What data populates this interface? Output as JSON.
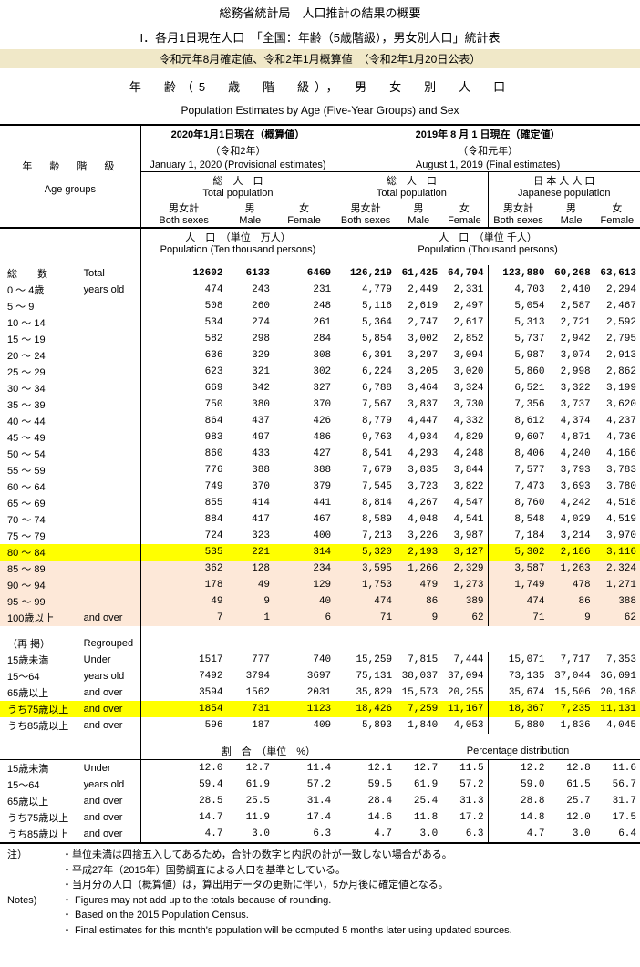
{
  "hdr1": "総務省統計局　人口推計の結果の概要",
  "hdr2": "I．各月1日現在人口　「全国：年齢（5歳階級），男女別人口」統計表",
  "band": "令和元年8月確定値、令和2年1月概算値　（令和2年1月20日公表）",
  "title_j": "年　齢（5　歳　階　級），　男　女　別　人　口",
  "title_e": "Population Estimates by  Age (Five-Year Groups) and  Sex",
  "colh": {
    "date1_j": "2020年1月1日現在（概算値）",
    "date1_sub": "（令和2年）",
    "date1_e": "January 1, 2020 (Provisional estimates)",
    "date2_j": "2019年 8 月 1 日現在（確定値）",
    "date2_sub": "（令和元年）",
    "date2_e": "August 1, 2019  (Final estimates)",
    "age_j": "年　齢　階　級",
    "age_e": "Age groups",
    "tot_j": "総　人　口",
    "tot_e": "Total  population",
    "jpn_j": "日 本 人 人 口",
    "jpn_e": "Japanese  population",
    "both_j": "男女計",
    "both_e": "Both sexes",
    "m_j": "男",
    "m_e": "Male",
    "f_j": "女",
    "f_e": "Female",
    "unit1_j": "人　口　（単位　万人）",
    "unit1_e": "Population  (Ten thousand persons)",
    "unit2_j": "人　口　（単位 千人）",
    "unit2_e": "Population   (Thousand persons)"
  },
  "rows": [
    {
      "j": "総　　数",
      "e": "Total",
      "a": [
        "12602",
        "6133",
        "6469"
      ],
      "b": [
        "126,219",
        "61,425",
        "64,794"
      ],
      "c": [
        "123,880",
        "60,268",
        "63,613"
      ],
      "bold": true
    },
    {
      "j": " 0 ～  4歳",
      "e": "years old",
      "a": [
        "474",
        "243",
        "231"
      ],
      "b": [
        "4,779",
        "2,449",
        "2,331"
      ],
      "c": [
        "4,703",
        "2,410",
        "2,294"
      ]
    },
    {
      "j": " 5 ～  9",
      "e": "",
      "a": [
        "508",
        "260",
        "248"
      ],
      "b": [
        "5,116",
        "2,619",
        "2,497"
      ],
      "c": [
        "5,054",
        "2,587",
        "2,467"
      ]
    },
    {
      "j": "10 ～ 14",
      "e": "",
      "a": [
        "534",
        "274",
        "261"
      ],
      "b": [
        "5,364",
        "2,747",
        "2,617"
      ],
      "c": [
        "5,313",
        "2,721",
        "2,592"
      ]
    },
    {
      "j": "15 ～ 19",
      "e": "",
      "a": [
        "582",
        "298",
        "284"
      ],
      "b": [
        "5,854",
        "3,002",
        "2,852"
      ],
      "c": [
        "5,737",
        "2,942",
        "2,795"
      ]
    },
    {
      "j": "20 ～ 24",
      "e": "",
      "a": [
        "636",
        "329",
        "308"
      ],
      "b": [
        "6,391",
        "3,297",
        "3,094"
      ],
      "c": [
        "5,987",
        "3,074",
        "2,913"
      ]
    },
    {
      "j": "25 ～ 29",
      "e": "",
      "a": [
        "623",
        "321",
        "302"
      ],
      "b": [
        "6,224",
        "3,205",
        "3,020"
      ],
      "c": [
        "5,860",
        "2,998",
        "2,862"
      ]
    },
    {
      "j": "30 ～ 34",
      "e": "",
      "a": [
        "669",
        "342",
        "327"
      ],
      "b": [
        "6,788",
        "3,464",
        "3,324"
      ],
      "c": [
        "6,521",
        "3,322",
        "3,199"
      ]
    },
    {
      "j": "35 ～ 39",
      "e": "",
      "a": [
        "750",
        "380",
        "370"
      ],
      "b": [
        "7,567",
        "3,837",
        "3,730"
      ],
      "c": [
        "7,356",
        "3,737",
        "3,620"
      ]
    },
    {
      "j": "40 ～ 44",
      "e": "",
      "a": [
        "864",
        "437",
        "426"
      ],
      "b": [
        "8,779",
        "4,447",
        "4,332"
      ],
      "c": [
        "8,612",
        "4,374",
        "4,237"
      ]
    },
    {
      "j": "45 ～ 49",
      "e": "",
      "a": [
        "983",
        "497",
        "486"
      ],
      "b": [
        "9,763",
        "4,934",
        "4,829"
      ],
      "c": [
        "9,607",
        "4,871",
        "4,736"
      ]
    },
    {
      "j": "50 ～ 54",
      "e": "",
      "a": [
        "860",
        "433",
        "427"
      ],
      "b": [
        "8,541",
        "4,293",
        "4,248"
      ],
      "c": [
        "8,406",
        "4,240",
        "4,166"
      ]
    },
    {
      "j": "55 ～ 59",
      "e": "",
      "a": [
        "776",
        "388",
        "388"
      ],
      "b": [
        "7,679",
        "3,835",
        "3,844"
      ],
      "c": [
        "7,577",
        "3,793",
        "3,783"
      ]
    },
    {
      "j": "60 ～ 64",
      "e": "",
      "a": [
        "749",
        "370",
        "379"
      ],
      "b": [
        "7,545",
        "3,723",
        "3,822"
      ],
      "c": [
        "7,473",
        "3,693",
        "3,780"
      ]
    },
    {
      "j": "65 ～ 69",
      "e": "",
      "a": [
        "855",
        "414",
        "441"
      ],
      "b": [
        "8,814",
        "4,267",
        "4,547"
      ],
      "c": [
        "8,760",
        "4,242",
        "4,518"
      ]
    },
    {
      "j": "70 ～ 74",
      "e": "",
      "a": [
        "884",
        "417",
        "467"
      ],
      "b": [
        "8,589",
        "4,048",
        "4,541"
      ],
      "c": [
        "8,548",
        "4,029",
        "4,519"
      ]
    },
    {
      "j": "75 ～ 79",
      "e": "",
      "a": [
        "724",
        "323",
        "400"
      ],
      "b": [
        "7,213",
        "3,226",
        "3,987"
      ],
      "c": [
        "7,184",
        "3,214",
        "3,970"
      ]
    },
    {
      "j": "80 ～ 84",
      "e": "",
      "a": [
        "535",
        "221",
        "314"
      ],
      "b": [
        "5,320",
        "2,193",
        "3,127"
      ],
      "c": [
        "5,302",
        "2,186",
        "3,116"
      ],
      "hl": true
    },
    {
      "j": "85 ～ 89",
      "e": "",
      "a": [
        "362",
        "128",
        "234"
      ],
      "b": [
        "3,595",
        "1,266",
        "2,329"
      ],
      "c": [
        "3,587",
        "1,263",
        "2,324"
      ],
      "pk": true
    },
    {
      "j": "90 ～ 94",
      "e": "",
      "a": [
        "178",
        "49",
        "129"
      ],
      "b": [
        "1,753",
        "479",
        "1,273"
      ],
      "c": [
        "1,749",
        "478",
        "1,271"
      ],
      "pk": true
    },
    {
      "j": "95 ～ 99",
      "e": "",
      "a": [
        "49",
        "9",
        "40"
      ],
      "b": [
        "474",
        "86",
        "389"
      ],
      "c": [
        "474",
        "86",
        "388"
      ],
      "pk": true
    },
    {
      "j": "100歳以上",
      "e": "and over",
      "a": [
        "7",
        "1",
        "6"
      ],
      "b": [
        "71",
        "9",
        "62"
      ],
      "c": [
        "71",
        "9",
        "62"
      ],
      "pk": true
    }
  ],
  "regroup_j": "（再 掲）",
  "regroup_e": "Regrouped",
  "rg": [
    {
      "j": "15歳未満",
      "e": "Under",
      "a": [
        "1517",
        "777",
        "740"
      ],
      "b": [
        "15,259",
        "7,815",
        "7,444"
      ],
      "c": [
        "15,071",
        "7,717",
        "7,353"
      ]
    },
    {
      "j": "15～64",
      "e": "years old",
      "a": [
        "7492",
        "3794",
        "3697"
      ],
      "b": [
        "75,131",
        "38,037",
        "37,094"
      ],
      "c": [
        "73,135",
        "37,044",
        "36,091"
      ]
    },
    {
      "j": "65歳以上",
      "e": "and over",
      "a": [
        "3594",
        "1562",
        "2031"
      ],
      "b": [
        "35,829",
        "15,573",
        "20,255"
      ],
      "c": [
        "35,674",
        "15,506",
        "20,168"
      ]
    },
    {
      "j": "うち75歳以上",
      "e": "and over",
      "a": [
        "1854",
        "731",
        "1123"
      ],
      "b": [
        "18,426",
        "7,259",
        "11,167"
      ],
      "c": [
        "18,367",
        "7,235",
        "11,131"
      ],
      "hl": true
    },
    {
      "j": "うち85歳以上",
      "e": "and over",
      "a": [
        "596",
        "187",
        "409"
      ],
      "b": [
        "5,893",
        "1,840",
        "4,053"
      ],
      "c": [
        "5,880",
        "1,836",
        "4,045"
      ]
    }
  ],
  "pct_j": "割　合　（単位　%）",
  "pct_e": "Percentage distribution",
  "pct": [
    {
      "j": "15歳未満",
      "e": "Under",
      "a": [
        "12.0",
        "12.7",
        "11.4"
      ],
      "b": [
        "12.1",
        "12.7",
        "11.5"
      ],
      "c": [
        "12.2",
        "12.8",
        "11.6"
      ]
    },
    {
      "j": "15～64",
      "e": "years old",
      "a": [
        "59.4",
        "61.9",
        "57.2"
      ],
      "b": [
        "59.5",
        "61.9",
        "57.2"
      ],
      "c": [
        "59.0",
        "61.5",
        "56.7"
      ]
    },
    {
      "j": "65歳以上",
      "e": "and over",
      "a": [
        "28.5",
        "25.5",
        "31.4"
      ],
      "b": [
        "28.4",
        "25.4",
        "31.3"
      ],
      "c": [
        "28.8",
        "25.7",
        "31.7"
      ]
    },
    {
      "j": "うち75歳以上",
      "e": "and over",
      "a": [
        "14.7",
        "11.9",
        "17.4"
      ],
      "b": [
        "14.6",
        "11.8",
        "17.2"
      ],
      "c": [
        "14.8",
        "12.0",
        "17.5"
      ]
    },
    {
      "j": "うち85歳以上",
      "e": "and over",
      "a": [
        "4.7",
        "3.0",
        "6.3"
      ],
      "b": [
        "4.7",
        "3.0",
        "6.3"
      ],
      "c": [
        "4.7",
        "3.0",
        "6.4"
      ]
    }
  ],
  "notes_j_label": "注）",
  "notes_e_label": "Notes)",
  "notes_j": [
    "・単位未満は四捨五入してあるため，合計の数字と内訳の計が一致しない場合がある。",
    "・平成27年（2015年）国勢調査による人口を基準としている。",
    "・当月分の人口（概算値）は，算出用データの更新に伴い，5か月後に確定値となる。"
  ],
  "notes_e": [
    "・ Figures may not add up to the totals because of rounding.",
    "・ Based on the 2015 Population Census.",
    "・ Final estimates for this month's population will be computed 5 months later using updated sources."
  ]
}
